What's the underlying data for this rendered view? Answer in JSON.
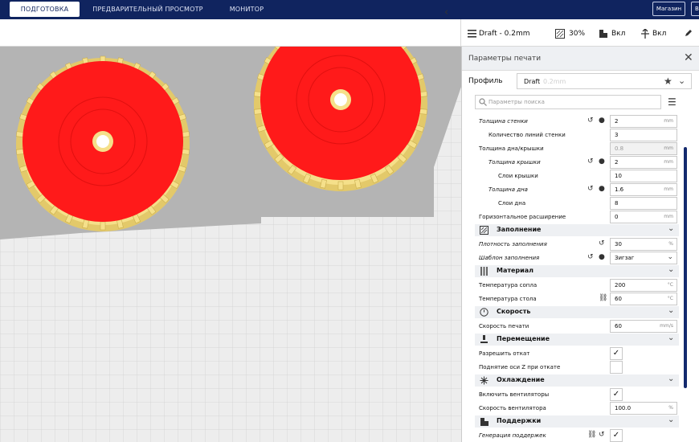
{
  "topbar": {
    "tabs": [
      "ПОДГОТОВКА",
      "ПРЕДВАРИТЕЛЬНЫЙ ПРОСМОТР",
      "МОНИТОР"
    ],
    "active_tab": "ПОДГОТОВКА",
    "marketplace_label": "Магазин",
    "login_label": "Вход"
  },
  "toolbar": {
    "profile_summary": "Draft - 0.2mm",
    "infill_summary": "30%",
    "support_summary": "Вкл",
    "adhesion_summary": "Вкл"
  },
  "panel": {
    "title": "Параметры печати",
    "profile_label": "Профиль",
    "profile_name": "Draft",
    "profile_sub": "0.2mm",
    "search_placeholder": "Параметры поиска"
  },
  "settings": {
    "wall_thickness": {
      "label": "Толщина стенки",
      "value": "2",
      "unit": "mm"
    },
    "wall_line_count": {
      "label": "Количество линий стенки",
      "value": "3"
    },
    "top_bottom_thickness": {
      "label": "Толщина дна/крышки",
      "value": "0.8",
      "unit": "mm"
    },
    "top_thickness": {
      "label": "Толщина крышки",
      "value": "2",
      "unit": "mm"
    },
    "top_layers": {
      "label": "Слои крышки",
      "value": "10"
    },
    "bottom_thickness": {
      "label": "Толщина дна",
      "value": "1.6",
      "unit": "mm"
    },
    "bottom_layers": {
      "label": "Слои дна",
      "value": "8"
    },
    "horizontal_expansion": {
      "label": "Горизонтальное расширение",
      "value": "0",
      "unit": "mm"
    },
    "infill_header": "Заполнение",
    "infill_density": {
      "label": "Плотность заполнения",
      "value": "30",
      "unit": "%"
    },
    "infill_pattern": {
      "label": "Шаблон заполнения",
      "value": "Зигзаг"
    },
    "material_header": "Материал",
    "nozzle_temp": {
      "label": "Температура сопла",
      "value": "200",
      "unit": "°C"
    },
    "bed_temp": {
      "label": "Температура стола",
      "value": "60",
      "unit": "°C"
    },
    "speed_header": "Скорость",
    "print_speed": {
      "label": "Скорость печати",
      "value": "60",
      "unit": "mm/s"
    },
    "travel_header": "Перемещение",
    "retraction": {
      "label": "Разрешить откат",
      "checked": true
    },
    "z_hop": {
      "label": "Поднятие оси Z при откате",
      "checked": false
    },
    "cooling_header": "Охлаждение",
    "fans": {
      "label": "Включить вентиляторы",
      "checked": true
    },
    "fan_speed": {
      "label": "Скорость вентилятора",
      "value": "100.0",
      "unit": "%"
    },
    "support_header": "Поддержки",
    "support_gen": {
      "label": "Генерация поддержек",
      "checked": true
    }
  },
  "colors": {
    "topbar": "#10245f",
    "model_face": "#ff1a1a",
    "model_body": "#f5e08a",
    "build_plate": "#ededed",
    "shadow": "#aaaaaa",
    "scroll": "#142a6e"
  }
}
